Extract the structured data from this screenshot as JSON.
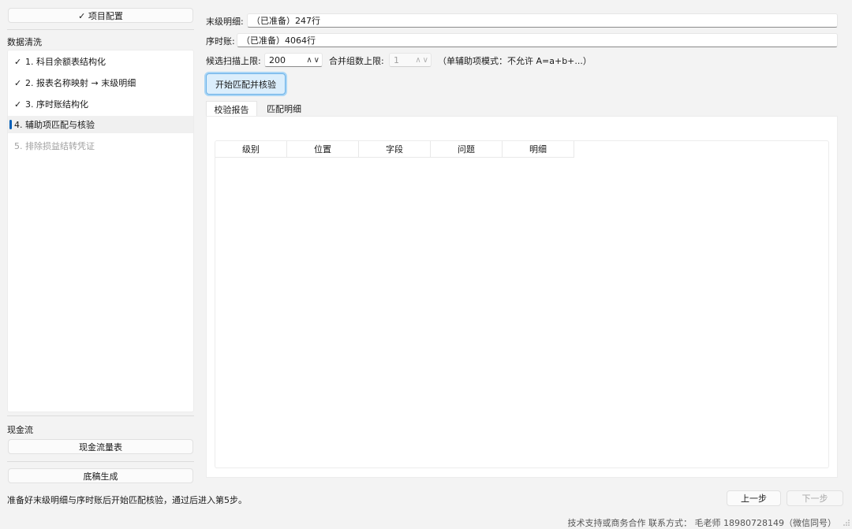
{
  "sidebar": {
    "project_config_label": "✓ 项目配置",
    "section_data_cleaning": "数据清洗",
    "steps": [
      {
        "check": "✓",
        "label": "1. 科目余额表结构化"
      },
      {
        "check": "✓",
        "label": "2. 报表名称映射 → 末级明细"
      },
      {
        "check": "✓",
        "label": "3. 序时账结构化"
      },
      {
        "check": "",
        "label": "4. 辅助项匹配与核验"
      },
      {
        "check": "",
        "label": "5. 排除损益结转凭证"
      }
    ],
    "section_cash_flow": "现金流",
    "cash_flow_button": "现金流量表",
    "draft_button": "底稿生成"
  },
  "main": {
    "detail_label": "末级明细:",
    "detail_value": "（已准备）247行",
    "journal_label": "序时账:",
    "journal_value": "（已准备）4064行",
    "scan_limit_label": "候选扫描上限:",
    "scan_limit_value": "200",
    "merge_limit_label": "合并组数上限:",
    "merge_limit_value": "1",
    "mode_note": "（单辅助项模式：不允许 A=a+b+...）",
    "start_button": "开始匹配并核验",
    "tabs": [
      "校验报告",
      "匹配明细"
    ],
    "table_columns": [
      "级别",
      "位置",
      "字段",
      "问题",
      "明细"
    ]
  },
  "status": {
    "message": "准备好末级明细与序时账后开始匹配核验，通过后进入第5步。",
    "prev_button": "上一步",
    "next_button": "下一步",
    "footer": "技术支持或商务合作 联系方式： 毛老师 18980728149（微信同号）"
  },
  "colors": {
    "accent": "#005fb8",
    "start_button_bg": "#dbeefc",
    "start_button_border": "#6fb3e8"
  }
}
